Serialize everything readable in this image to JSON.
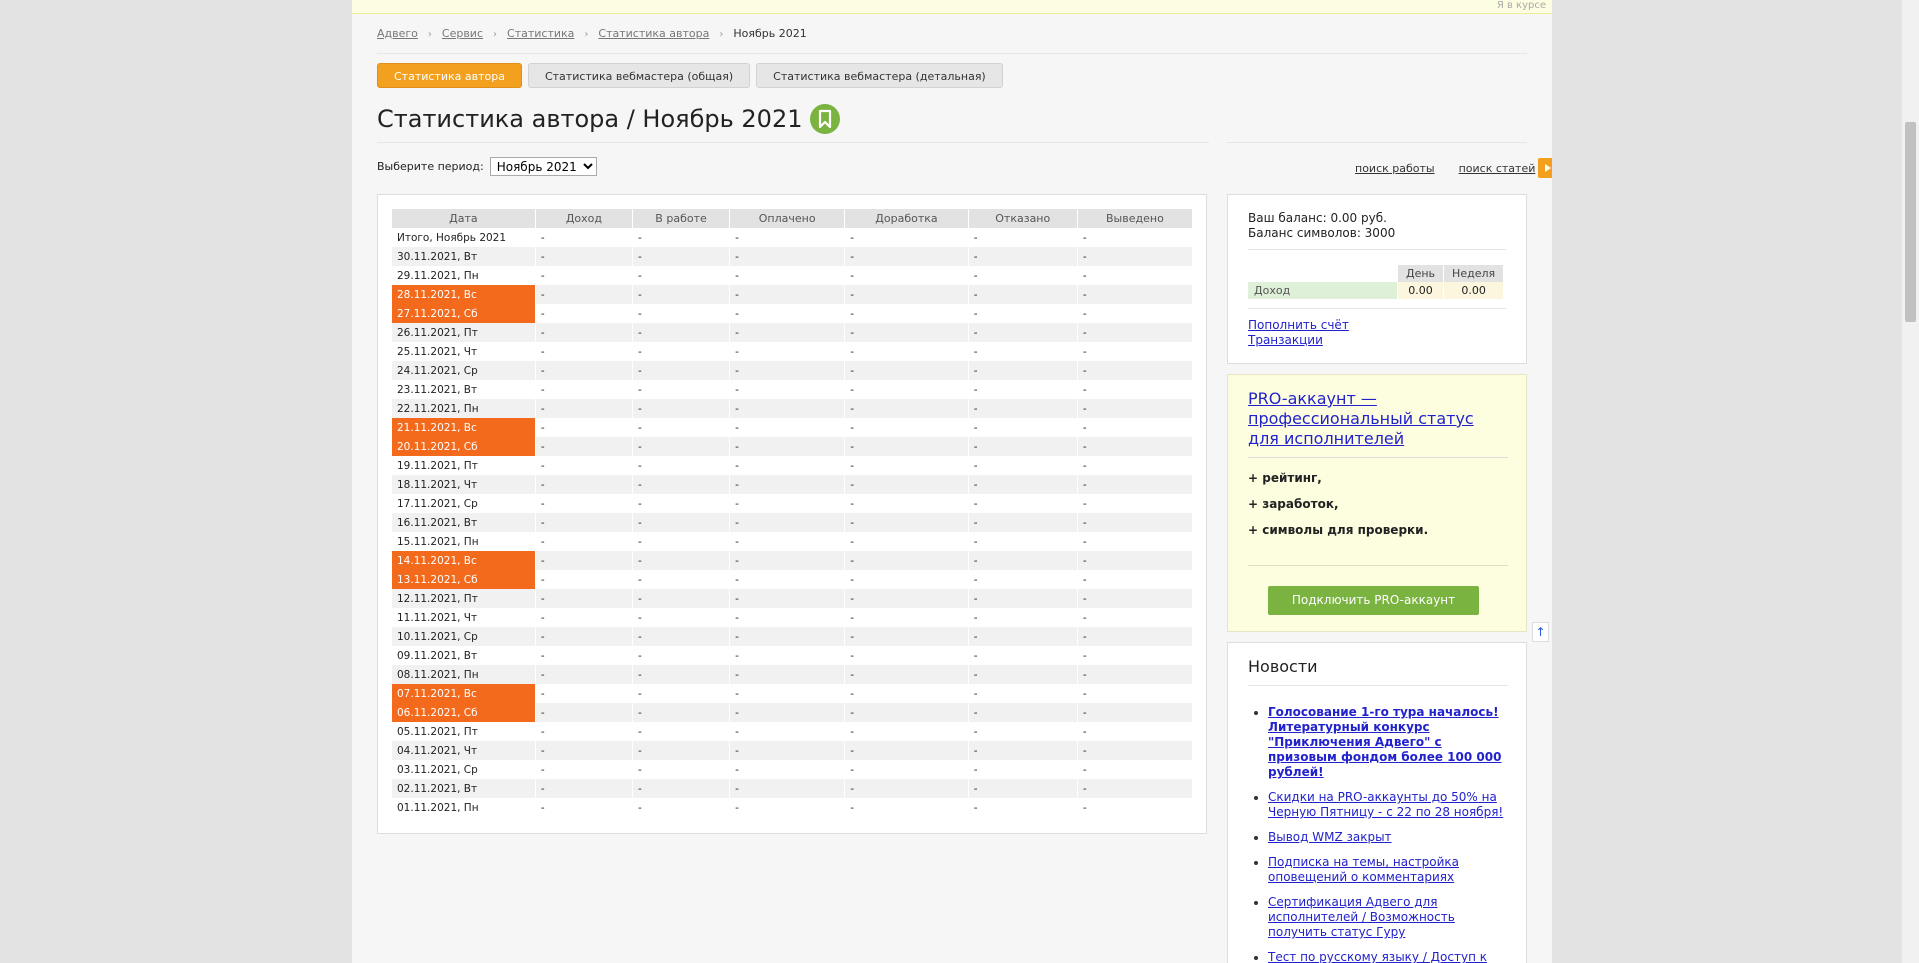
{
  "topbar": {
    "notice": "Я в курсе"
  },
  "breadcrumb": {
    "items": [
      "Адвего",
      "Сервис",
      "Статистика",
      "Статистика автора"
    ],
    "current": "Ноябрь 2021"
  },
  "tabs": [
    {
      "label": "Статистика автора",
      "active": true
    },
    {
      "label": "Статистика вебмастера (общая)",
      "active": false
    },
    {
      "label": "Статистика вебмастера (детальная)",
      "active": false
    }
  ],
  "page_title": "Статистика автора / Ноябрь 2021",
  "period": {
    "label": "Выберите период:",
    "selected": "Ноябрь 2021"
  },
  "side_links": {
    "job_search": "поиск работы",
    "article_search": "поиск статей"
  },
  "stats_table": {
    "headers": [
      "Дата",
      "Доход",
      "В работе",
      "Оплачено",
      "Доработка",
      "Отказано",
      "Выведено"
    ],
    "rows": [
      {
        "date": "Итого, Ноябрь 2021",
        "weekend": false
      },
      {
        "date": "30.11.2021, Вт",
        "weekend": false
      },
      {
        "date": "29.11.2021, Пн",
        "weekend": false
      },
      {
        "date": "28.11.2021, Вс",
        "weekend": true
      },
      {
        "date": "27.11.2021, Сб",
        "weekend": true
      },
      {
        "date": "26.11.2021, Пт",
        "weekend": false
      },
      {
        "date": "25.11.2021, Чт",
        "weekend": false
      },
      {
        "date": "24.11.2021, Ср",
        "weekend": false
      },
      {
        "date": "23.11.2021, Вт",
        "weekend": false
      },
      {
        "date": "22.11.2021, Пн",
        "weekend": false
      },
      {
        "date": "21.11.2021, Вс",
        "weekend": true
      },
      {
        "date": "20.11.2021, Сб",
        "weekend": true
      },
      {
        "date": "19.11.2021, Пт",
        "weekend": false
      },
      {
        "date": "18.11.2021, Чт",
        "weekend": false
      },
      {
        "date": "17.11.2021, Ср",
        "weekend": false
      },
      {
        "date": "16.11.2021, Вт",
        "weekend": false
      },
      {
        "date": "15.11.2021, Пн",
        "weekend": false
      },
      {
        "date": "14.11.2021, Вс",
        "weekend": true
      },
      {
        "date": "13.11.2021, Сб",
        "weekend": true
      },
      {
        "date": "12.11.2021, Пт",
        "weekend": false
      },
      {
        "date": "11.11.2021, Чт",
        "weekend": false
      },
      {
        "date": "10.11.2021, Ср",
        "weekend": false
      },
      {
        "date": "09.11.2021, Вт",
        "weekend": false
      },
      {
        "date": "08.11.2021, Пн",
        "weekend": false
      },
      {
        "date": "07.11.2021, Вс",
        "weekend": true
      },
      {
        "date": "06.11.2021, Сб",
        "weekend": true
      },
      {
        "date": "05.11.2021, Пт",
        "weekend": false
      },
      {
        "date": "04.11.2021, Чт",
        "weekend": false
      },
      {
        "date": "03.11.2021, Ср",
        "weekend": false
      },
      {
        "date": "02.11.2021, Вт",
        "weekend": false
      },
      {
        "date": "01.11.2021, Пн",
        "weekend": false
      }
    ],
    "empty_value": "-"
  },
  "balance": {
    "balance_line": "Ваш баланс: 0.00 руб.",
    "symbols_line": "Баланс символов: 3000",
    "mini_table": {
      "headers": [
        "День",
        "Неделя"
      ],
      "row_label": "Доход",
      "values": [
        "0.00",
        "0.00"
      ]
    },
    "links": [
      "Пополнить счёт",
      "Транзакции"
    ]
  },
  "pro": {
    "title": "PRO-аккаунт — профессиональный статус для исполнителей",
    "benefits": [
      "+ рейтинг,",
      "+ заработок,",
      "+ символы для проверки."
    ],
    "button": "Подключить PRO-аккаунт"
  },
  "news": {
    "title": "Новости",
    "items": [
      {
        "text": "Голосование 1-го тура началось! Литературный конкурс \"Приключения Адвего\" с призовым фондом более 100 000 рублей!",
        "bold": true
      },
      {
        "text": "Скидки на PRO-аккаунты до 50% на Черную Пятницу - с 22 по 28 ноября!",
        "bold": false
      },
      {
        "text": "Вывод WMZ закрыт",
        "bold": false
      },
      {
        "text": "Подписка на темы, настройка оповещений о комментариях",
        "bold": false
      },
      {
        "text": "Сертификация Адвего для исполнителей / Возможность получить статус Гуру",
        "bold": false
      },
      {
        "text": "Тест по русскому языку / Доступ к тендерам по копирайтингу для",
        "bold": false
      }
    ]
  },
  "colors": {
    "accent_orange": "#f2a01d",
    "weekend_red": "#f36a1d",
    "pro_green": "#7ab340",
    "link_blue": "#2222cc"
  }
}
